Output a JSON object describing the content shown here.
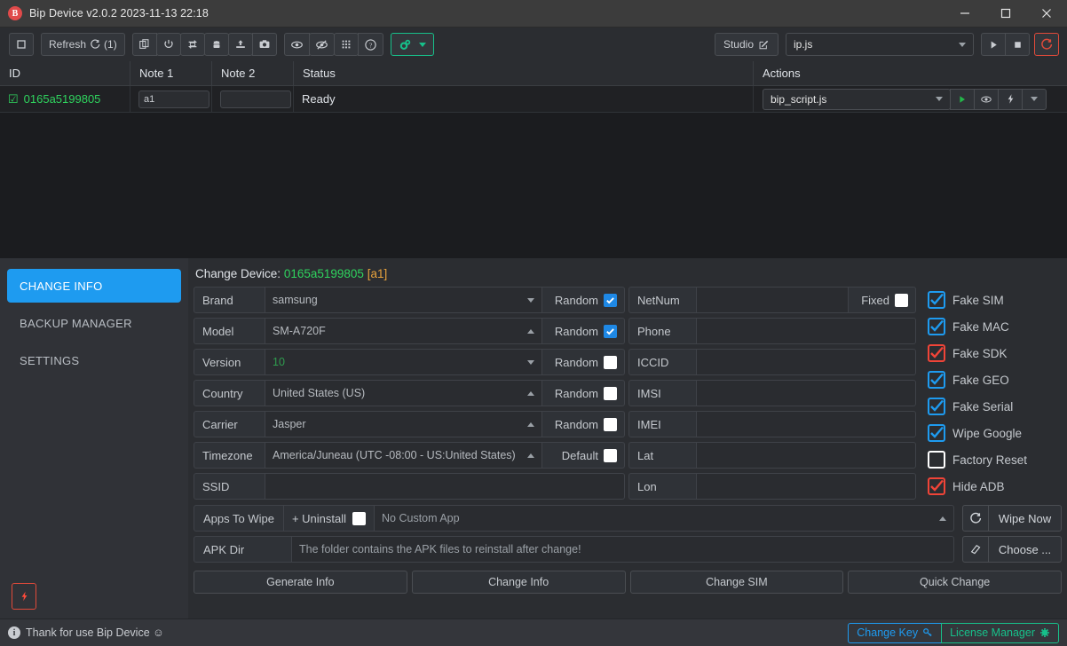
{
  "window": {
    "title": "Bip Device v2.0.2 2023-11-13 22:18",
    "logo_letter": "B",
    "minimize_label": "minimize",
    "maximize_label": "maximize",
    "close_label": "close"
  },
  "toolbar": {
    "stop_icon": "square-icon",
    "refresh_label": "Refresh",
    "refresh_count": "(1)",
    "icons": [
      {
        "name": "copy-icon"
      },
      {
        "name": "power-icon"
      },
      {
        "name": "reboot-icon"
      },
      {
        "name": "android-icon"
      },
      {
        "name": "upload-icon"
      },
      {
        "name": "camera-icon"
      }
    ],
    "icons2": [
      {
        "name": "eye-icon"
      },
      {
        "name": "eye-off-icon"
      },
      {
        "name": "grid-icon"
      },
      {
        "name": "help-icon"
      }
    ],
    "settings_icon": "gears-icon",
    "settings_caret": "chevron-down-icon",
    "studio_label": "Studio",
    "studio_icon": "edit-icon",
    "script_value": "ip.js",
    "play_icon": "play-icon",
    "stop_square_icon": "stop-icon",
    "reload_icon": "reload-icon"
  },
  "table": {
    "headers": {
      "id": "ID",
      "note1": "Note 1",
      "note2": "Note 2",
      "status": "Status",
      "actions": "Actions"
    },
    "rows": [
      {
        "checked_icon": "checked-box-icon",
        "id": "0165a5199805",
        "note1": "a1",
        "note2": "",
        "status": "Ready",
        "action_script": "bip_script.js",
        "action_icons": [
          "play-icon",
          "eye-icon",
          "bolt-icon",
          "chevron-down-icon"
        ]
      }
    ]
  },
  "sidebar": {
    "items": [
      {
        "label": "CHANGE INFO",
        "active": true
      },
      {
        "label": "BACKUP MANAGER",
        "active": false
      },
      {
        "label": "SETTINGS",
        "active": false
      }
    ],
    "bolt_icon": "bolt-icon"
  },
  "panel": {
    "title_prefix": "Change Device:",
    "device_id": "0165a5199805",
    "device_tag": "[a1]",
    "left_rows": [
      {
        "label": "Brand",
        "value": "samsung",
        "caret": "down",
        "green": false,
        "opt_label": "Random",
        "opt_checked": true
      },
      {
        "label": "Model",
        "value": "SM-A720F",
        "caret": "up",
        "green": false,
        "opt_label": "Random",
        "opt_checked": true
      },
      {
        "label": "Version",
        "value": "10",
        "caret": "down",
        "green": true,
        "opt_label": "Random",
        "opt_checked": false
      },
      {
        "label": "Country",
        "value": "United States (US)",
        "caret": "up",
        "green": false,
        "opt_label": "Random",
        "opt_checked": false
      },
      {
        "label": "Carrier",
        "value": "Jasper",
        "caret": "up",
        "green": false,
        "opt_label": "Random",
        "opt_checked": false
      },
      {
        "label": "Timezone",
        "value": "America/Juneau (UTC -08:00 - US:United States)",
        "caret": "up",
        "green": false,
        "opt_label": "Default",
        "opt_checked": false
      },
      {
        "label": "SSID",
        "value": "",
        "caret": "",
        "green": false,
        "opt_label": "",
        "opt_checked": false
      }
    ],
    "mid_rows": [
      {
        "label": "NetNum",
        "value": "",
        "opt_label": "Fixed",
        "opt_checked": false
      },
      {
        "label": "Phone",
        "value": "",
        "opt_label": "",
        "opt_checked": false
      },
      {
        "label": "ICCID",
        "value": "",
        "opt_label": "",
        "opt_checked": false
      },
      {
        "label": "IMSI",
        "value": "",
        "opt_label": "",
        "opt_checked": false
      },
      {
        "label": "IMEI",
        "value": "",
        "opt_label": "",
        "opt_checked": false
      },
      {
        "label": "Lat",
        "value": "",
        "opt_label": "",
        "opt_checked": false
      },
      {
        "label": "Lon",
        "value": "",
        "opt_label": "",
        "opt_checked": false
      }
    ],
    "checks": [
      {
        "label": "Fake SIM",
        "checked": true,
        "color": "blue"
      },
      {
        "label": "Fake MAC",
        "checked": true,
        "color": "blue"
      },
      {
        "label": "Fake SDK",
        "checked": true,
        "color": "red"
      },
      {
        "label": "Fake GEO",
        "checked": true,
        "color": "blue"
      },
      {
        "label": "Fake Serial",
        "checked": true,
        "color": "blue"
      },
      {
        "label": "Wipe Google",
        "checked": true,
        "color": "blue"
      },
      {
        "label": "Factory Reset",
        "checked": false,
        "color": "white"
      },
      {
        "label": "Hide ADB",
        "checked": true,
        "color": "red"
      }
    ],
    "apps_row": {
      "label": "Apps To Wipe",
      "uninstall_label": "+ Uninstall",
      "uninstall_checked": false,
      "custom_app": "No Custom App",
      "caret": "up",
      "side_icon": "refresh-icon",
      "side_label": "Wipe Now"
    },
    "apk_row": {
      "label": "APK Dir",
      "value": "The folder contains the APK files to reinstall after change!",
      "side_icon": "eraser-icon",
      "side_label": "Choose ..."
    },
    "buttons": [
      {
        "label": "Generate Info"
      },
      {
        "label": "Change Info"
      },
      {
        "label": "Change SIM"
      },
      {
        "label": "Quick Change"
      }
    ]
  },
  "statusbar": {
    "info_icon": "info-icon",
    "message": "Thank for use Bip Device ☺",
    "change_key_label": "Change Key",
    "change_key_icon": "key-icon",
    "license_label": "License Manager",
    "license_icon": "gear-icon"
  },
  "colors": {
    "accent_blue": "#1e9bf0",
    "accent_green": "#17c08a",
    "accent_red": "#e04a3a",
    "device_green": "#2fd45e",
    "tag_orange": "#e8a33d"
  }
}
